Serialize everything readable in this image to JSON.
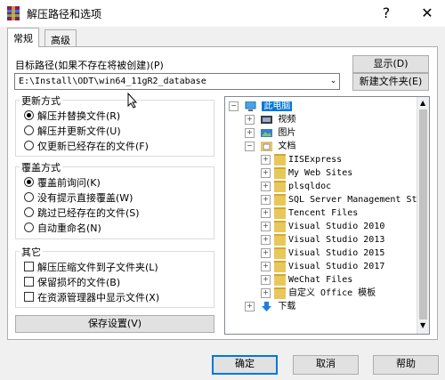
{
  "window": {
    "title": "解压路径和选项",
    "help_symbol": "?",
    "close_symbol": "✕"
  },
  "tabs": [
    {
      "label": "常规"
    },
    {
      "label": "高级"
    }
  ],
  "target": {
    "label": "目标路径(如果不存在将被创建)(P)",
    "value": "E:\\Install\\ODT\\win64_11gR2_database",
    "show_button": "显示(D)",
    "new_folder_button": "新建文件夹(E)"
  },
  "update_mode": {
    "title": "更新方式",
    "options": [
      {
        "label": "解压并替换文件(R)",
        "selected": true
      },
      {
        "label": "解压并更新文件(U)",
        "selected": false
      },
      {
        "label": "仅更新已经存在的文件(F)",
        "selected": false
      }
    ]
  },
  "overwrite_mode": {
    "title": "覆盖方式",
    "options": [
      {
        "label": "覆盖前询问(K)",
        "selected": true
      },
      {
        "label": "没有提示直接覆盖(W)",
        "selected": false
      },
      {
        "label": "跳过已经存在的文件(S)",
        "selected": false
      },
      {
        "label": "自动重命名(N)",
        "selected": false
      }
    ]
  },
  "misc": {
    "title": "其它",
    "options": [
      {
        "label": "解压压缩文件到子文件夹(L)",
        "checked": false
      },
      {
        "label": "保留损坏的文件(B)",
        "checked": false
      },
      {
        "label": "在资源管理器中显示文件(X)",
        "checked": false
      }
    ]
  },
  "save_button": "保存设置(V)",
  "tree": {
    "root": "此电脑",
    "top_items": [
      "视频",
      "图片",
      "文档"
    ],
    "doc_children": [
      "IISExpress",
      "My Web Sites",
      "plsqldoc",
      "SQL Server Management St",
      "Tencent Files",
      "Visual Studio 2010",
      "Visual Studio 2013",
      "Visual Studio 2015",
      "Visual Studio 2017",
      "WeChat Files",
      "自定义 Office 模板"
    ],
    "bottom_items": [
      "下载"
    ]
  },
  "footer": {
    "ok": "确定",
    "cancel": "取消",
    "help": "帮助"
  },
  "colors": {
    "accent": "#0078d7",
    "folder": "#e8c85a"
  }
}
